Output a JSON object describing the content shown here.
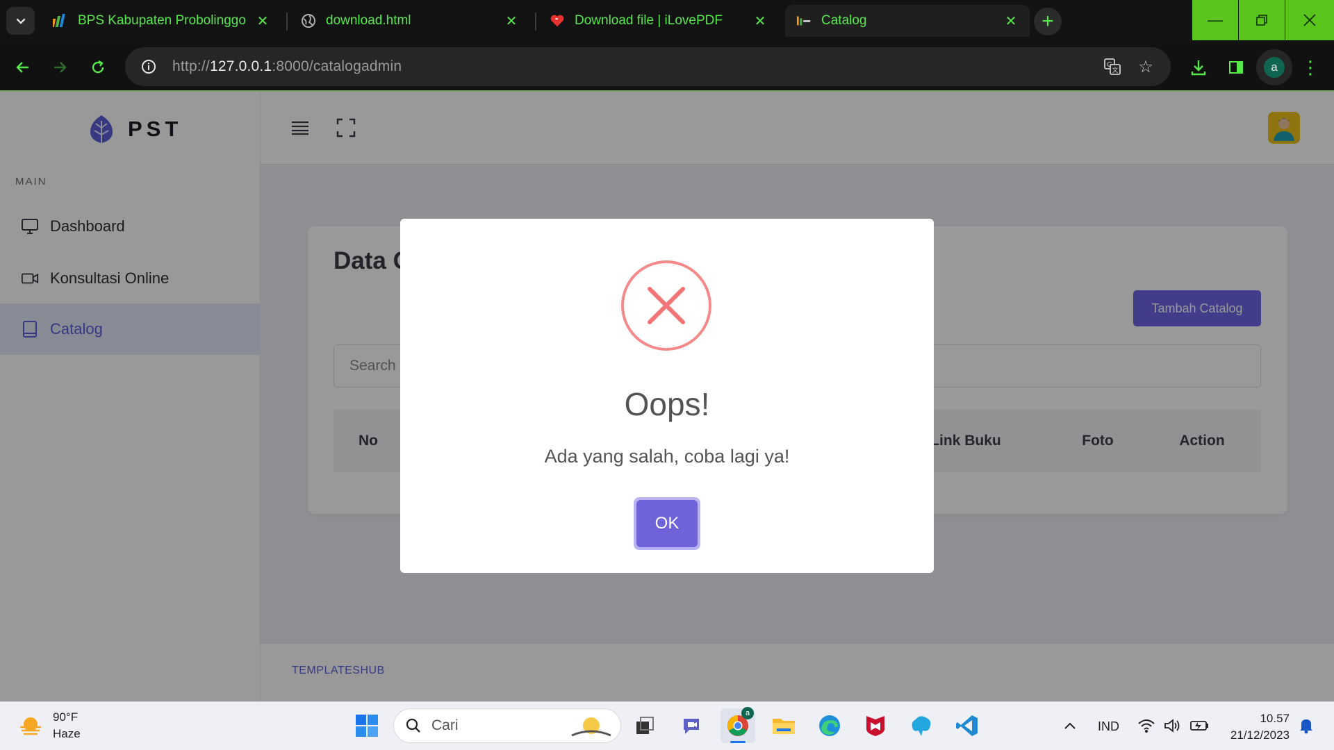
{
  "browser": {
    "tabs": [
      {
        "label": "BPS Kabupaten Probolinggo",
        "icon": "bps-favicon",
        "active": false
      },
      {
        "label": "download.html",
        "icon": "globe-icon",
        "active": false
      },
      {
        "label": "Download file | iLovePDF",
        "icon": "ilovepdf-heart-icon",
        "active": false
      },
      {
        "label": "Catalog",
        "icon": "catalog-favicon",
        "active": true
      }
    ],
    "url_prefix": "http://",
    "url_host": "127.0.0.1",
    "url_rest": ":8000/catalogadmin",
    "profile_initial": "a",
    "accent_color": "#57e84c"
  },
  "sidebar": {
    "brand": "PST",
    "section_title": "MAIN",
    "items": [
      {
        "label": "Dashboard",
        "icon": "monitor-icon",
        "active": false
      },
      {
        "label": "Konsultasi Online",
        "icon": "video-icon",
        "active": false
      },
      {
        "label": "Catalog",
        "icon": "book-icon",
        "active": true
      }
    ]
  },
  "main": {
    "card_title": "Data Catalog",
    "add_button": "Tambah Catalog",
    "search_placeholder": "Search",
    "columns": [
      "No",
      "Link Buku",
      "Foto",
      "Action"
    ]
  },
  "footer": {
    "text": "TEMPLATESHUB"
  },
  "modal": {
    "title": "Oops!",
    "text": "Ada yang salah, coba lagi ya!",
    "ok_label": "OK",
    "icon": "error-x-icon",
    "icon_color": "#f27474",
    "button_color": "#6e63d8"
  },
  "taskbar": {
    "weather_temp": "90°F",
    "weather_desc": "Haze",
    "search_placeholder": "Cari",
    "language": "IND",
    "time": "10.57",
    "date": "21/12/2023",
    "chrome_badge": "a"
  }
}
